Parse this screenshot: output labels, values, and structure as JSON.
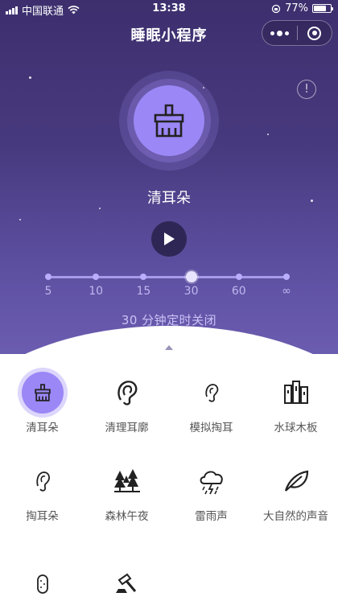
{
  "status_bar": {
    "carrier": "中国联通",
    "time": "13:38",
    "battery_percent": "77%",
    "battery_level": 0.77
  },
  "nav": {
    "title": "睡眠小程序"
  },
  "player": {
    "current_sound": "清耳朵",
    "timer_options": [
      "5",
      "10",
      "15",
      "30",
      "60",
      "∞"
    ],
    "timer_selected_index": 3,
    "timer_text": "30 分钟定时关闭"
  },
  "sounds": [
    {
      "label": "清耳朵",
      "icon": "brush-icon",
      "active": true
    },
    {
      "label": "清理耳廓",
      "icon": "ear-outline-icon",
      "active": false
    },
    {
      "label": "模拟掏耳",
      "icon": "ear-small-icon",
      "active": false
    },
    {
      "label": "水球木板",
      "icon": "wood-boards-icon",
      "active": false
    },
    {
      "label": "掏耳朵",
      "icon": "ear-icon",
      "active": false
    },
    {
      "label": "森林午夜",
      "icon": "forest-icon",
      "active": false
    },
    {
      "label": "雷雨声",
      "icon": "thunderstorm-icon",
      "active": false
    },
    {
      "label": "大自然的声音",
      "icon": "leaf-icon",
      "active": false
    },
    {
      "label": "",
      "icon": "capsule-icon",
      "active": false
    },
    {
      "label": "",
      "icon": "hammer-icon",
      "active": false
    }
  ],
  "colors": {
    "accent": "#9b87f5",
    "header_top": "#3d2f6e",
    "header_bottom": "#6b5cb0"
  }
}
